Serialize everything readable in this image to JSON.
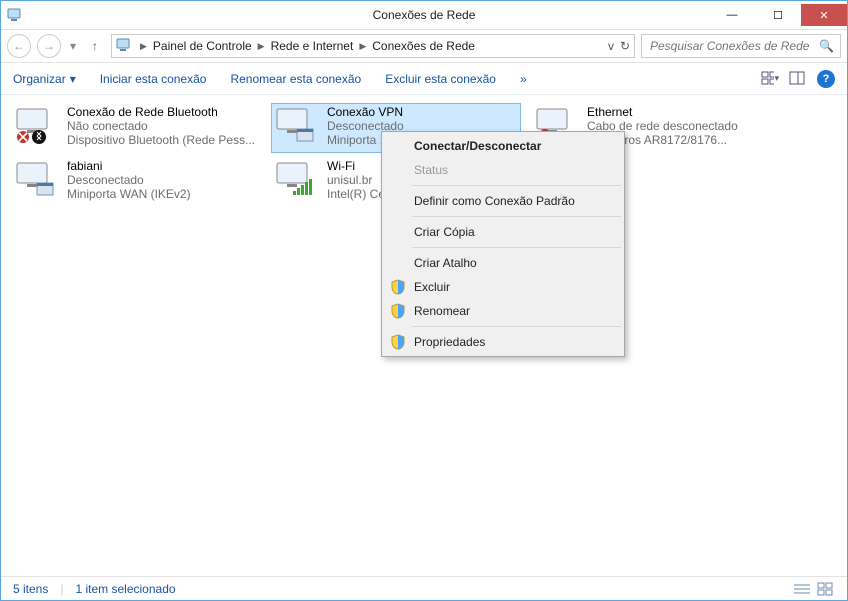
{
  "title": "Conexões de Rede",
  "breadcrumb": [
    "Painel de Controle",
    "Rede e Internet",
    "Conexões de Rede"
  ],
  "search_placeholder": "Pesquisar Conexões de Rede",
  "toolbar": {
    "organize": "Organizar",
    "start": "Iniciar esta conexão",
    "rename": "Renomear esta conexão",
    "delete": "Excluir esta conexão"
  },
  "connections": [
    {
      "name": "Conexão de Rede Bluetooth",
      "status": "Não conectado",
      "device": "Dispositivo Bluetooth (Rede Pess...",
      "type": "bluetooth"
    },
    {
      "name": "Conexão VPN",
      "status": "Desconectado",
      "device": "Miniporta ...",
      "type": "vpn",
      "selected": true
    },
    {
      "name": "Ethernet",
      "status": "Cabo de rede desconectado",
      "device": "... Atheros AR8172/8176...",
      "type": "eth"
    },
    {
      "name": "fabiani",
      "status": "Desconectado",
      "device": "Miniporta WAN (IKEv2)",
      "type": "wan"
    },
    {
      "name": "Wi-Fi",
      "status": "unisul.br",
      "device": "Intel(R) Ce...",
      "type": "wifi"
    }
  ],
  "context_menu": {
    "connect": "Conectar/Desconectar",
    "status": "Status",
    "default": "Definir como Conexão Padrão",
    "copy": "Criar Cópia",
    "shortcut": "Criar Atalho",
    "delete": "Excluir",
    "rename": "Renomear",
    "properties": "Propriedades"
  },
  "statusbar": {
    "items": "5 itens",
    "sel": "1 item selecionado"
  }
}
